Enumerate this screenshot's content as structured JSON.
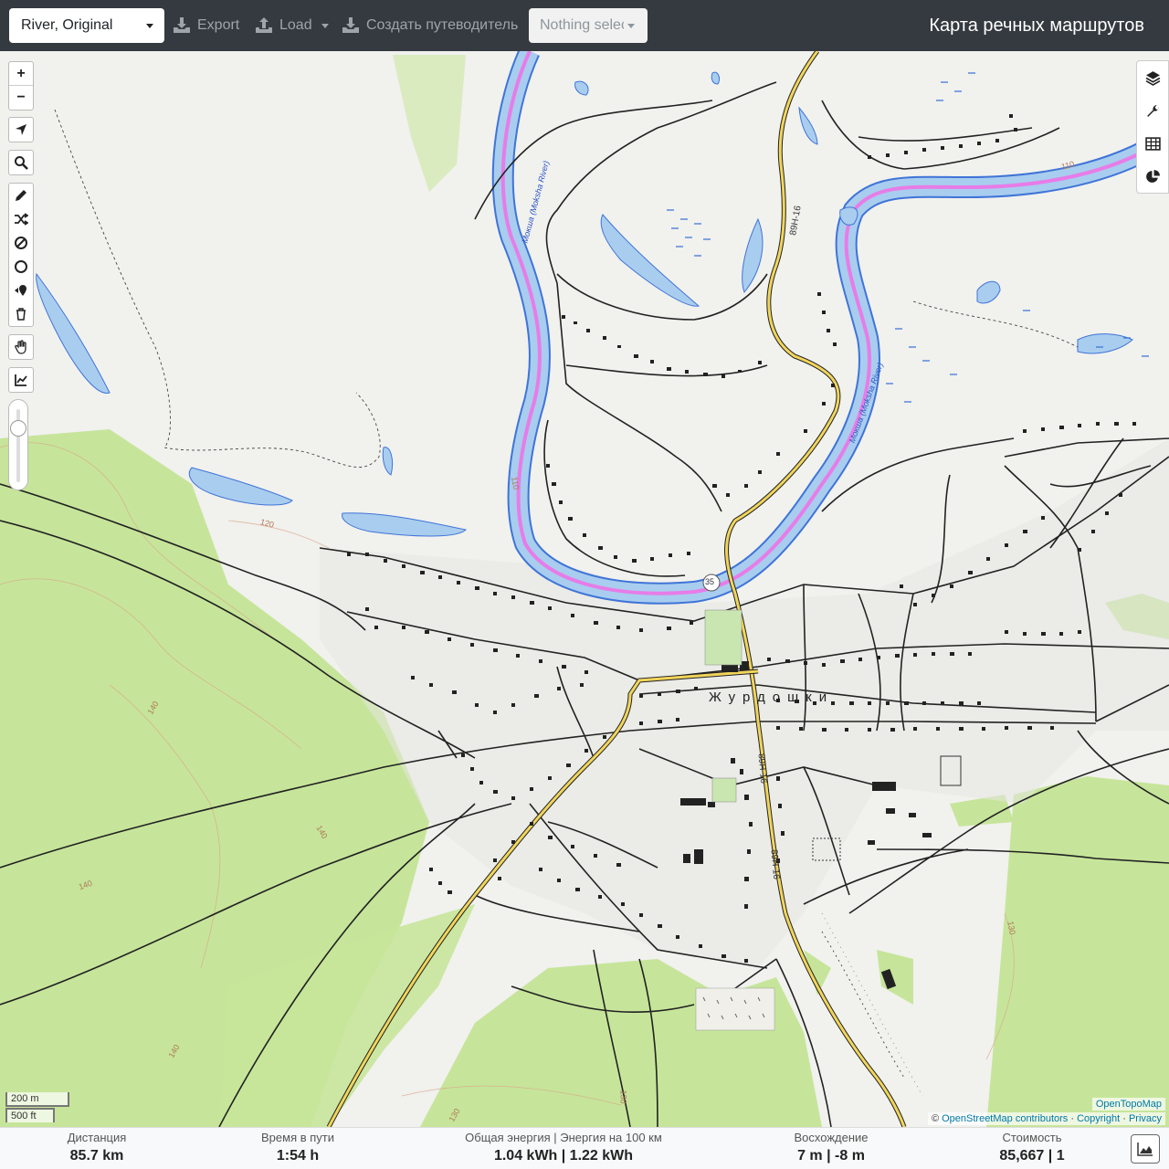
{
  "navbar": {
    "profile_select": "River, Original",
    "export_label": "Export",
    "load_label": "Load",
    "create_guide_label": "Создать путеводитель",
    "route_select_placeholder": "Nothing selected",
    "brand_title": "Карта речных маршрутов"
  },
  "map": {
    "town_name": "Журдошки",
    "river_label_1": "Мокша (Moksha River)",
    "river_label_2": "Мокша (Moksha River)",
    "road_label_1": "89Н-16",
    "road_label_2": "89Н-16",
    "road_label_3": "89Н-16",
    "route_shield": "35",
    "contour_labels": [
      "110",
      "120",
      "140",
      "140",
      "140",
      "140",
      "130",
      "130",
      "130",
      "110"
    ],
    "scale_metric": "200 m",
    "scale_imperial": "500 ft",
    "attribution_layer": "OpenTopoMap",
    "attribution_prefix": "©",
    "attribution_osm": "OpenStreetMap contributors",
    "attribution_copyright": "Copyright",
    "attribution_privacy": "Privacy",
    "colors": {
      "water": "#a9cdee",
      "river_stroke": "#3f74d8",
      "route": "#e77ce8",
      "forest": "#c6e59a",
      "road_major": "#f1d55a"
    }
  },
  "left_toolbar": {
    "zoom_in": "+",
    "zoom_out": "−",
    "icons": [
      "locate-icon",
      "search-icon",
      "pencil-icon",
      "shuffle-icon",
      "no-entry-icon",
      "circle-icon",
      "pin-icon",
      "trash-icon",
      "hand-icon",
      "chart-line-icon"
    ]
  },
  "right_toolbar": {
    "icons": [
      "layers-icon",
      "wrench-icon",
      "table-icon",
      "pie-chart-icon"
    ]
  },
  "footer": {
    "distance_label": "Дистанция",
    "distance_value": "85.7 km",
    "time_label": "Время в пути",
    "time_value": "1:54 h",
    "energy_label": "Общая энергия | Энергия на 100 км",
    "energy_value": "1.04 kWh | 1.22 kWh",
    "ascent_label": "Восхождение",
    "ascent_value": "7 m | -8 m",
    "cost_label": "Стоимость",
    "cost_value": "85,667 | 1"
  }
}
